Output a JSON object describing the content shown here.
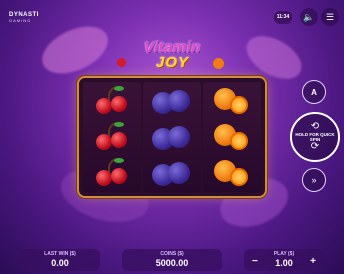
{
  "brand": {
    "name": "DYNASTI",
    "sub": "GAMING"
  },
  "header": {
    "clock": "11:34"
  },
  "title": {
    "line1": "Vitamin",
    "line2": "JOY"
  },
  "reels": [
    [
      "cherry",
      "cherry",
      "cherry"
    ],
    [
      "plum",
      "plum",
      "plum"
    ],
    [
      "orange",
      "orange",
      "orange"
    ]
  ],
  "controls": {
    "auto_label": "A",
    "spin_label": "HOLD FOR QUICK SPIN",
    "turbo_label": "»"
  },
  "footer": {
    "last_win_label": "LAST WIN ($)",
    "last_win_value": "0.00",
    "coins_label": "COINS ($)",
    "coins_value": "5000.00",
    "play_label": "PLAY ($)",
    "play_value": "1.00",
    "minus": "−",
    "plus": "+"
  }
}
